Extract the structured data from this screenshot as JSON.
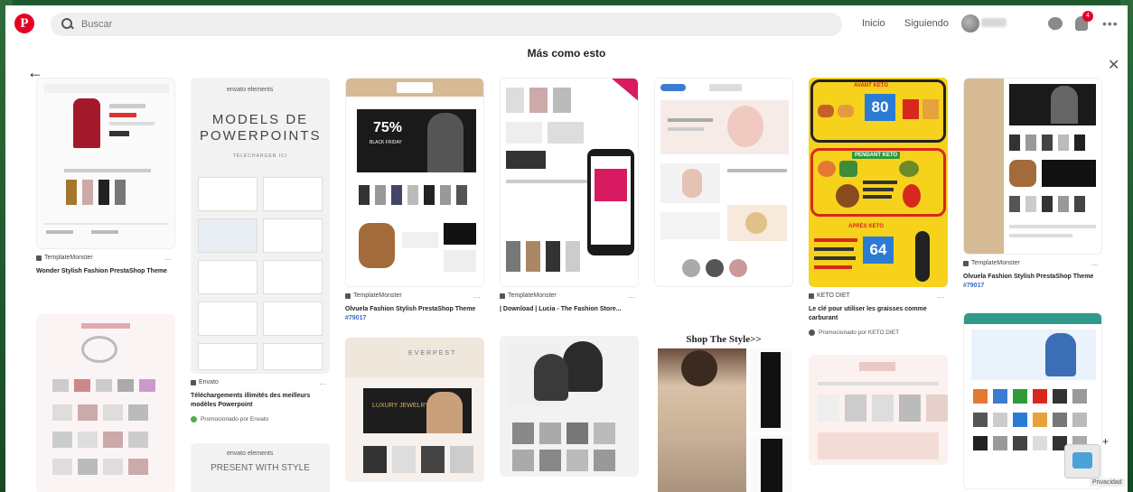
{
  "header": {
    "logo": "P",
    "search_placeholder": "Buscar",
    "nav_home": "Inicio",
    "nav_following": "Siguiendo",
    "more": "•••",
    "notification_count": "4"
  },
  "title": "Más como esto",
  "icons": {
    "back": "←",
    "close": "✕"
  },
  "pins": [
    {
      "source": "TemplateMonster",
      "title": "Wonder Stylish Fashion PrestaShop Theme",
      "more": "···"
    },
    {
      "image_heading": "MODELS DE POWERPOINTS",
      "image_brand": "envato elements",
      "image_subheading": "TÉLÉCHARGER ICI",
      "source": "Envato",
      "title": "Téléchargements illimités des meilleurs modèles Powerpoint",
      "promo": "Promocionado por Envato",
      "more": "···",
      "next_brand": "envato elements",
      "next_heading": "PRESENT WITH STYLE"
    },
    {
      "image_sale": "75%",
      "image_sale_text": "BLACK FRIDAY",
      "source": "TemplateMonster",
      "title_pre": "Olvuela Fashion Stylish PrestaShop Theme",
      "title_tag": "#79017",
      "more": "···",
      "next_heading": "EVERPEST",
      "next_sub": "LUXURY JEWELRY"
    },
    {
      "source": "TemplateMonster",
      "title": "| Download | Lucia - The Fashion Store...",
      "more": "···"
    },
    {
      "next_heading": "Shop The Style>>"
    },
    {
      "image_top": "AVANT KETO",
      "image_top_num": "80",
      "image_mid": "PENDANT KETO",
      "image_bot": "APRÈS KETO",
      "image_bot_num": "64",
      "source": "KETO DIET",
      "title": "Le clé pour utiliser les graisses comme carburant",
      "promo": "Promocionado por KETO DIET",
      "more": "···"
    },
    {
      "source": "TemplateMonster",
      "title_pre": "Olvuela Fashion Stylish PrestaShop Theme",
      "title_tag": "#79017",
      "more": "···"
    }
  ],
  "footer": {
    "privacy": "Privacidad",
    "plus": "+"
  },
  "colors": {
    "brand": "#e60023",
    "keto_yellow": "#f6d21c",
    "keto_red": "#d8281e"
  }
}
